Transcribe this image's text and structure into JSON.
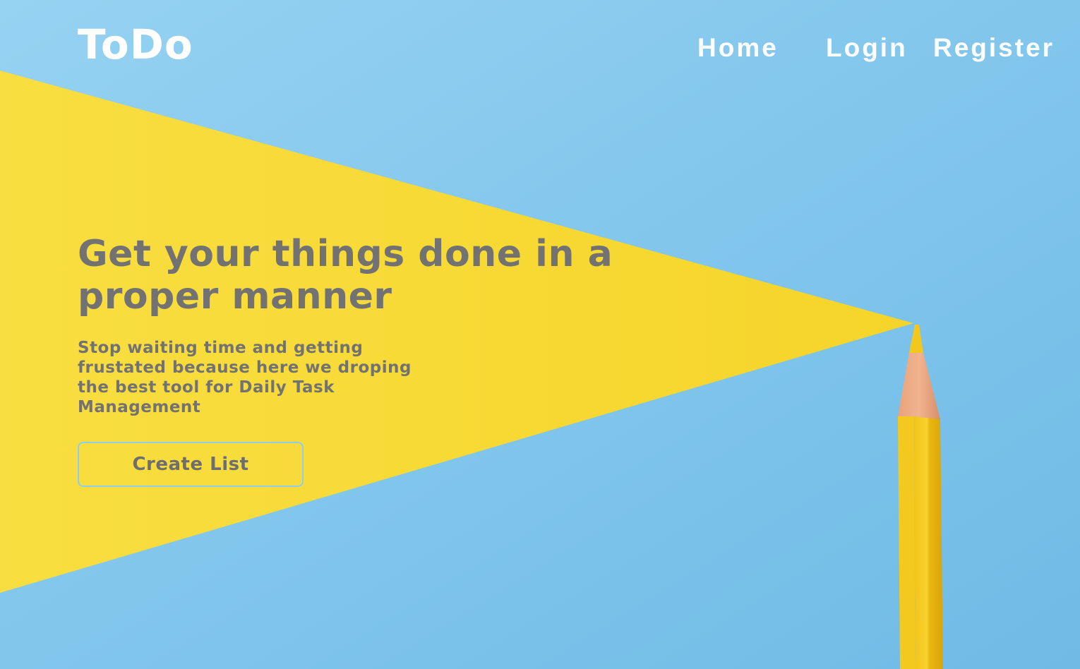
{
  "brand": {
    "logo_text": "ToDo"
  },
  "nav": {
    "items": [
      {
        "label": "Home"
      },
      {
        "label": "Login"
      },
      {
        "label": "Register"
      }
    ]
  },
  "hero": {
    "headline": "Get your things done in a proper manner",
    "subtext": "Stop waiting time and getting\nfrustated  because here we droping\nthe best tool for Daily Task\nManagement",
    "cta_label": "Create List"
  },
  "colors": {
    "sky": "#87c8ec",
    "beam": "#f8dc3a",
    "text_gray": "#727272",
    "nav_text": "#ffffff",
    "cta_border": "#8ccdf0"
  }
}
